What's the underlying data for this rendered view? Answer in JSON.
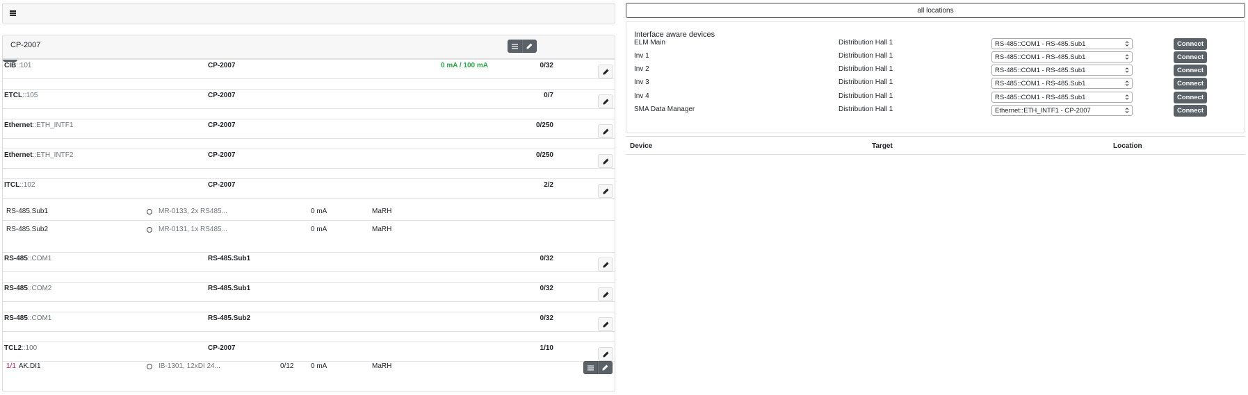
{
  "topbar": {
    "menu_icon": "hamburger-icon"
  },
  "card": {
    "title": "CP-2007",
    "header_buttons": [
      "list-icon",
      "pencil-icon"
    ]
  },
  "interfaces": [
    {
      "type": "CIB",
      "sep": "::",
      "id": "101",
      "target": "CP-2007",
      "current_used": "0 mA",
      "current_slash": " / ",
      "current_max": "100 mA",
      "count": "0/32"
    },
    {
      "type": "ETCL",
      "sep": "::",
      "id": "105",
      "target": "CP-2007",
      "count": "0/7"
    },
    {
      "type": "Ethernet",
      "sep": "::",
      "id": "ETH_INTF1",
      "target": "CP-2007",
      "count": "0/250"
    },
    {
      "type": "Ethernet",
      "sep": "::",
      "id": "ETH_INTF2",
      "target": "CP-2007",
      "count": "0/250"
    },
    {
      "type": "ITCL",
      "sep": "::",
      "id": "102",
      "target": "CP-2007",
      "count": "2/2"
    },
    {
      "type": "RS-485",
      "sep": "::",
      "id": "COM1",
      "target": "RS-485.Sub1",
      "count": "0/32"
    },
    {
      "type": "RS-485",
      "sep": "::",
      "id": "COM2",
      "target": "RS-485.Sub1",
      "count": "0/32"
    },
    {
      "type": "RS-485",
      "sep": "::",
      "id": "COM1",
      "target": "RS-485.Sub2",
      "count": "0/32"
    },
    {
      "type": "TCL2",
      "sep": "::",
      "id": "100",
      "target": "CP-2007",
      "count": "1/10"
    }
  ],
  "sub_items": [
    {
      "name": "RS-485.Sub1",
      "module": "MR-0133, 2x RS485...",
      "current": "0 mA",
      "location": "MaRH"
    },
    {
      "name": "RS-485.Sub2",
      "module": "MR-0131, 1x RS485...",
      "current": "0 mA",
      "location": "MaRH"
    }
  ],
  "tcl2_item": {
    "slot": "1/1",
    "name": "AK.DI1",
    "module": "IB-1301, 12xDI 24...",
    "count": "0/12",
    "current": "0 mA",
    "location": "MaRH"
  },
  "right": {
    "all_locations": "all locations",
    "iad_title": "Interface aware devices",
    "connect_label": "Connect",
    "devices": [
      {
        "name": "ELM Main",
        "location": "Distribution Hall 1",
        "selected": "RS-485::COM1 - RS-485.Sub1"
      },
      {
        "name": "Inv 1",
        "location": "Distribution Hall 1",
        "selected": "RS-485::COM1 - RS-485.Sub1"
      },
      {
        "name": "Inv 2",
        "location": "Distribution Hall 1",
        "selected": "RS-485::COM1 - RS-485.Sub1"
      },
      {
        "name": "Inv 3",
        "location": "Distribution Hall 1",
        "selected": "RS-485::COM1 - RS-485.Sub1"
      },
      {
        "name": "Inv 4",
        "location": "Distribution Hall 1",
        "selected": "RS-485::COM1 - RS-485.Sub1"
      },
      {
        "name": "SMA Data Manager",
        "location": "Distribution Hall 1",
        "selected": "Ethernet::ETH_INTF1 - CP-2007"
      }
    ],
    "table_headers": {
      "device": "Device",
      "target": "Target",
      "location": "Location"
    }
  },
  "colors": {
    "button": "#5a6268",
    "green": "#28a745",
    "pink": "#c2185b",
    "muted": "#6c757d"
  }
}
